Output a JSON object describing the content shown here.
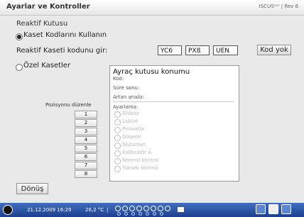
{
  "window": {
    "title": "Ayarlar ve Kontroller",
    "brand": "ISCUSᵉᵒᵗ | Rev 6"
  },
  "section": {
    "title": "Reaktif Kutusu"
  },
  "option_cassette_codes": {
    "label": "Kaset Kodlarını Kullanın",
    "selected": true
  },
  "reagent_code": {
    "label": "Reaktif Kaseti kodunu gir:",
    "fields": [
      "YC6",
      "PX8",
      "UEN",
      ""
    ],
    "no_code_button": "Kod yok"
  },
  "option_special": {
    "label": "Özel Kasetler",
    "selected": false
  },
  "divider_panel": {
    "title": "Ayraç kutusu konumu",
    "rows": [
      "Kod:",
      "Süre sonu:",
      "Artan analiz:"
    ],
    "setting_label": "Ayarlama:",
    "settings": [
      "Glükoz",
      "Laktat",
      "Pirüvatla",
      "Gliserol",
      "Glutamat",
      "Kalibratör A",
      "Normal kontrol",
      "Yüksek kontrol"
    ]
  },
  "positions": {
    "label": "Pozisyonu düzenle",
    "buttons": [
      "1",
      "2",
      "3",
      "4",
      "5",
      "6",
      "7",
      "8"
    ]
  },
  "back_button": {
    "label": "Dönüş"
  },
  "statusbar": {
    "datetime": "21.12.2009 16:29",
    "temperature": "26,2 °C",
    "separator": "|"
  }
}
